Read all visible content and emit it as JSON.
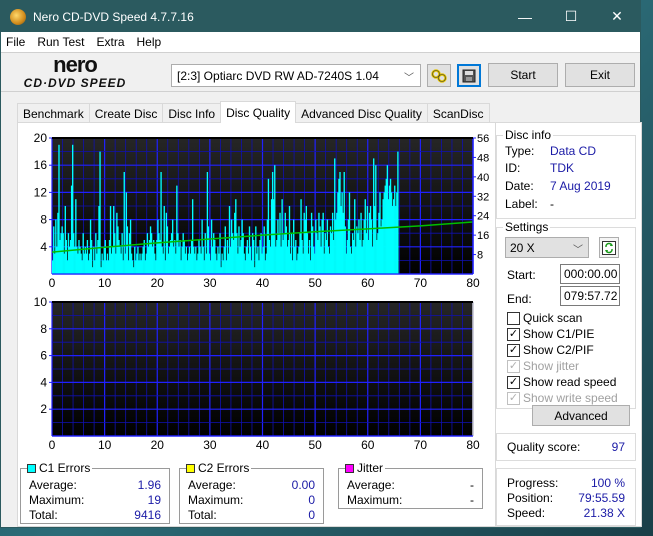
{
  "window": {
    "title": "Nero CD-DVD Speed 4.7.7.16",
    "controls": {
      "minimize": "—",
      "maximize": "☐",
      "close": "✕"
    }
  },
  "menu": [
    "File",
    "Run Test",
    "Extra",
    "Help"
  ],
  "toolbar": {
    "logo_top": "nero",
    "logo_bottom": "CD·DVD SPEED",
    "drive": "[2:3]  Optiarc DVD RW AD-7240S 1.04",
    "start_label": "Start",
    "exit_label": "Exit"
  },
  "tabs": [
    {
      "label": "Benchmark",
      "active": false
    },
    {
      "label": "Create Disc",
      "active": false
    },
    {
      "label": "Disc Info",
      "active": false
    },
    {
      "label": "Disc Quality",
      "active": true
    },
    {
      "label": "Advanced Disc Quality",
      "active": false
    },
    {
      "label": "ScanDisc",
      "active": false
    }
  ],
  "disc_info": {
    "title": "Disc info",
    "type_label": "Type:",
    "type": "Data CD",
    "id_label": "ID:",
    "id": "TDK",
    "date_label": "Date:",
    "date": "7 Aug 2019",
    "label_label": "Label:",
    "label": "-"
  },
  "settings": {
    "title": "Settings",
    "speed": "20 X",
    "start_label": "Start:",
    "start": "000:00.00",
    "end_label": "End:",
    "end": "079:57.72",
    "quick_scan": {
      "label": "Quick scan",
      "checked": false,
      "enabled": true
    },
    "show_c1": {
      "label": "Show C1/PIE",
      "checked": true,
      "enabled": true
    },
    "show_c2": {
      "label": "Show C2/PIF",
      "checked": true,
      "enabled": true
    },
    "show_jitter": {
      "label": "Show jitter",
      "checked": true,
      "enabled": false
    },
    "show_read": {
      "label": "Show read speed",
      "checked": true,
      "enabled": true
    },
    "show_write": {
      "label": "Show write speed",
      "checked": true,
      "enabled": false
    },
    "advanced_label": "Advanced"
  },
  "quality": {
    "label": "Quality score:",
    "value": "97"
  },
  "progress": {
    "progress_label": "Progress:",
    "progress": "100 %",
    "position_label": "Position:",
    "position": "79:55.59",
    "speed_label": "Speed:",
    "speed": "21.38 X"
  },
  "c1": {
    "title": "C1 Errors",
    "color": "#00ffff",
    "avg_label": "Average:",
    "avg": "1.96",
    "max_label": "Maximum:",
    "max": "19",
    "total_label": "Total:",
    "total": "9416"
  },
  "c2": {
    "title": "C2 Errors",
    "color": "#ffff00",
    "avg_label": "Average:",
    "avg": "0.00",
    "max_label": "Maximum:",
    "max": "0",
    "total_label": "Total:",
    "total": "0"
  },
  "jitter": {
    "title": "Jitter",
    "color": "#ff00ff",
    "avg_label": "Average:",
    "avg": "-",
    "max_label": "Maximum:",
    "max": "-"
  },
  "chart_data": [
    {
      "type": "bar",
      "title": "C1 Errors",
      "xlabel": "",
      "ylabel": "",
      "xlim": [
        0,
        80
      ],
      "ylim": [
        0,
        20
      ],
      "y2lim": [
        0,
        56
      ],
      "xticks": [
        0,
        10,
        20,
        30,
        40,
        50,
        60,
        70,
        80
      ],
      "yticks": [
        4,
        8,
        12,
        16,
        20
      ],
      "y2ticks": [
        8,
        16,
        24,
        32,
        40,
        48,
        56
      ],
      "grid": true,
      "series": [
        {
          "name": "C1 errors",
          "color": "#00ffff",
          "x_step": 0.2,
          "values": [
            2,
            7,
            3,
            8,
            4,
            9,
            19,
            5,
            6,
            7,
            6,
            3,
            10,
            5,
            2,
            6,
            4,
            5,
            13,
            19,
            6,
            4,
            11,
            4,
            3,
            5,
            4,
            3,
            2,
            6,
            3,
            4,
            3,
            5,
            2,
            3,
            8,
            5,
            1,
            4,
            2,
            6,
            3,
            5,
            10,
            18,
            1,
            3,
            2,
            4,
            5,
            2,
            3,
            2,
            5,
            10,
            3,
            4,
            10,
            6,
            3,
            9,
            7,
            5,
            4,
            3,
            6,
            2,
            15,
            3,
            12,
            7,
            2,
            6,
            8,
            3,
            2,
            1,
            4,
            2,
            3,
            4,
            2,
            3,
            2,
            3,
            4,
            5,
            2,
            3,
            6,
            4,
            5,
            7,
            6,
            4,
            5,
            3,
            2,
            5,
            8,
            6,
            5,
            15,
            4,
            3,
            10,
            2,
            9,
            7,
            3,
            4,
            5,
            6,
            8,
            4,
            5,
            3,
            13,
            6,
            4,
            5,
            2,
            4,
            6,
            5,
            3,
            4,
            2,
            3,
            4,
            3,
            5,
            11,
            4,
            3,
            4,
            2,
            3,
            5,
            4,
            3,
            8,
            4,
            2,
            6,
            3,
            15,
            7,
            3,
            2,
            8,
            4,
            6,
            5,
            3,
            2,
            4,
            3,
            6,
            1,
            3,
            2,
            4,
            7,
            2,
            5,
            3,
            10,
            4,
            8,
            6,
            5,
            9,
            11,
            6,
            3,
            7,
            4,
            5,
            8,
            6,
            3,
            2,
            4,
            5,
            3,
            7,
            4,
            2,
            6,
            5,
            1,
            7,
            3,
            4,
            2,
            5,
            6,
            3,
            4,
            7,
            2,
            3,
            8,
            14,
            5,
            4,
            11,
            15,
            11,
            16,
            4,
            5,
            8,
            6,
            9,
            4,
            11,
            5,
            6,
            9,
            7,
            4,
            5,
            10,
            3,
            6,
            2,
            8,
            4,
            5,
            2,
            3,
            4,
            6,
            11,
            5,
            3,
            9,
            8,
            10,
            6,
            3,
            5,
            2,
            9,
            7,
            4,
            3,
            8,
            6,
            5,
            9,
            7,
            4,
            8,
            9,
            3,
            6,
            5,
            8,
            4,
            3,
            7,
            6,
            9,
            5,
            17,
            8,
            9,
            12,
            14,
            15,
            10,
            12,
            9,
            15,
            7,
            3,
            5,
            8,
            12,
            4,
            3,
            6,
            5,
            11,
            4,
            7,
            6,
            8,
            5,
            9,
            4,
            5,
            8,
            11,
            6,
            10,
            5,
            9,
            10,
            8,
            4,
            17,
            10,
            16,
            5,
            6,
            9,
            12,
            7,
            8,
            11,
            12,
            13,
            14,
            16,
            11,
            13,
            14,
            12,
            10,
            11,
            13,
            10,
            12,
            18
          ]
        },
        {
          "name": "Read speed",
          "color": "#00c000",
          "axis": "right",
          "x": [
            0,
            10,
            20,
            30,
            40,
            50,
            60,
            70,
            79.9
          ],
          "values": [
            9.0,
            11.0,
            12.8,
            14.4,
            16.0,
            17.4,
            18.6,
            19.8,
            21.4
          ]
        }
      ]
    },
    {
      "type": "bar",
      "title": "C2 Errors",
      "xlim": [
        0,
        80
      ],
      "ylim": [
        0,
        10
      ],
      "xticks": [
        0,
        10,
        20,
        30,
        40,
        50,
        60,
        70,
        80
      ],
      "yticks": [
        2,
        4,
        6,
        8,
        10
      ],
      "grid": true,
      "series": [
        {
          "name": "C2 errors",
          "color": "#ffff00",
          "values": []
        }
      ]
    }
  ]
}
